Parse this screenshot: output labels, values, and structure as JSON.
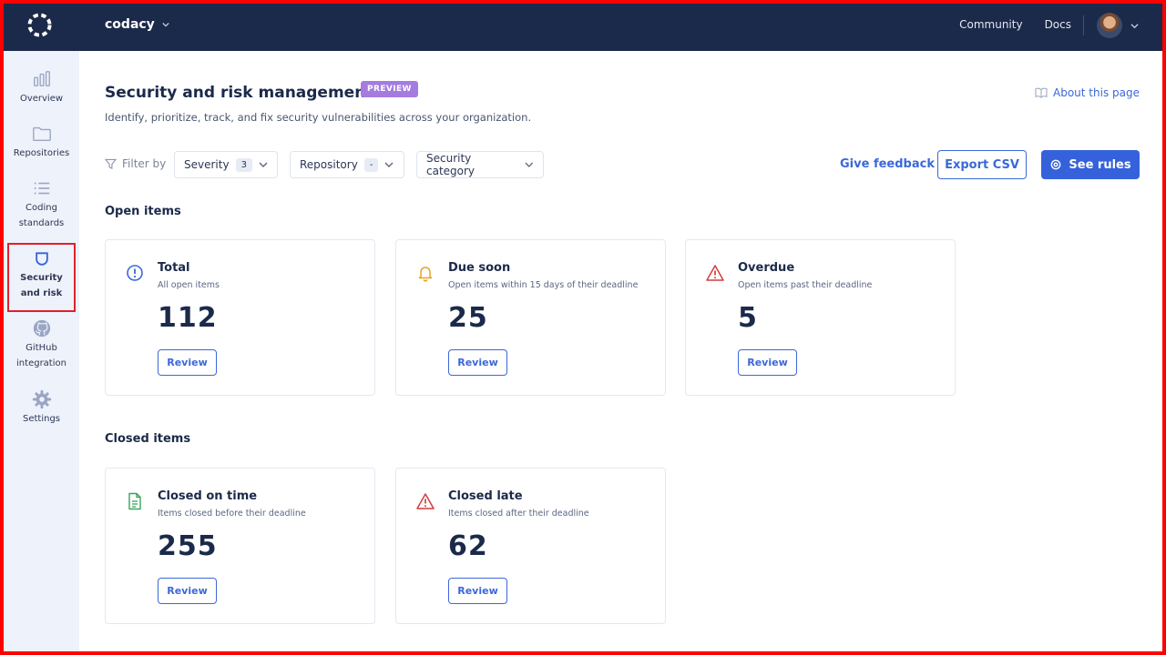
{
  "topbar": {
    "org_name": "codacy",
    "links": {
      "community": "Community",
      "docs": "Docs"
    }
  },
  "sidebar": {
    "items": [
      {
        "label": "Overview",
        "icon": "bar-chart-icon"
      },
      {
        "label": "Repositories",
        "icon": "folder-icon"
      },
      {
        "label": "Coding standards",
        "icon": "list-icon"
      },
      {
        "label": "Security and risk",
        "icon": "shield-icon",
        "active": true
      },
      {
        "label": "GitHub integration",
        "icon": "github-icon"
      },
      {
        "label": "Settings",
        "icon": "gear-icon"
      }
    ]
  },
  "page": {
    "title": "Security and risk management",
    "badge": "PREVIEW",
    "about_link": "About this page",
    "subtitle": "Identify, prioritize, track, and fix security vulnerabilities across your organization."
  },
  "filters": {
    "filter_by_label": "Filter by",
    "severity": {
      "label": "Severity",
      "count": "3"
    },
    "repository": {
      "label": "Repository",
      "count": "-"
    },
    "security_category": {
      "label": "Security category"
    }
  },
  "actions": {
    "give_feedback": "Give feedback",
    "export_csv": "Export CSV",
    "see_rules": "See rules"
  },
  "open_items": {
    "title": "Open items",
    "cards": [
      {
        "title": "Total",
        "desc": "All open items",
        "value": "112",
        "button": "Review",
        "icon": "info-circle-icon",
        "color": "#3b68d8"
      },
      {
        "title": "Due soon",
        "desc": "Open items within 15 days of their deadline",
        "value": "25",
        "button": "Review",
        "icon": "bell-icon",
        "color": "#e8a21e"
      },
      {
        "title": "Overdue",
        "desc": "Open items past their deadline",
        "value": "5",
        "button": "Review",
        "icon": "warning-triangle-icon",
        "color": "#d63c3c"
      }
    ]
  },
  "closed_items": {
    "title": "Closed items",
    "cards": [
      {
        "title": "Closed on time",
        "desc": "Items closed before their deadline",
        "value": "255",
        "button": "Review",
        "icon": "document-icon",
        "color": "#3aa35a"
      },
      {
        "title": "Closed late",
        "desc": "Items closed after their deadline",
        "value": "62",
        "button": "Review",
        "icon": "warning-triangle-icon",
        "color": "#d63c3c"
      }
    ]
  },
  "colors": {
    "topbar": "#1b2a4a",
    "accent": "#3562db",
    "sidebar_bg": "#eef2fb",
    "preview_badge": "#a67bdf",
    "active_outline": "#e0202c"
  }
}
